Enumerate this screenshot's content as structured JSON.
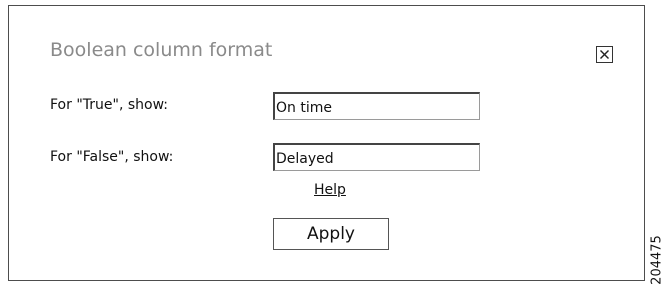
{
  "dialog": {
    "title": "Boolean column format",
    "close_icon": "close-x-icon",
    "true_label": "For \"True\", show:",
    "true_value": "On time",
    "false_label": "For \"False\", show:",
    "false_value": "Delayed",
    "help_label": "Help",
    "apply_label": "Apply"
  },
  "figure_id": "204475"
}
